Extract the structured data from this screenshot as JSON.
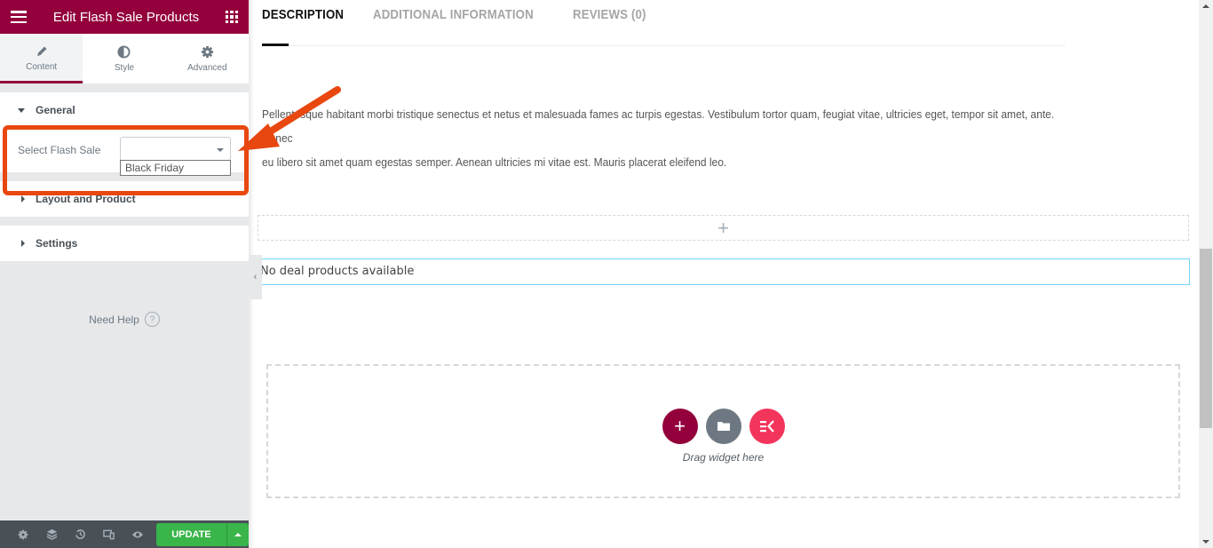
{
  "panel": {
    "title": "Edit Flash Sale Products",
    "tabs": [
      {
        "label": "Content",
        "icon": "pencil-icon",
        "active": true
      },
      {
        "label": "Style",
        "icon": "contrast-icon",
        "active": false
      },
      {
        "label": "Advanced",
        "icon": "gear-icon",
        "active": false
      }
    ],
    "sections": {
      "general": {
        "label": "General",
        "expanded": true
      },
      "layout": {
        "label": "Layout and Product",
        "expanded": false
      },
      "settings": {
        "label": "Settings",
        "expanded": false
      }
    },
    "select_flash_sale": {
      "label": "Select Flash Sale",
      "value": "",
      "options": [
        "Black Friday"
      ]
    },
    "need_help": "Need Help",
    "footer": {
      "update_label": "UPDATE",
      "icons": [
        "gear-icon",
        "layers-icon",
        "history-icon",
        "responsive-icon",
        "eye-icon"
      ]
    }
  },
  "main": {
    "tabs": [
      {
        "label": "DESCRIPTION",
        "active": true
      },
      {
        "label": "ADDITIONAL INFORMATION",
        "active": false
      },
      {
        "label": "REVIEWS (0)",
        "active": false
      }
    ],
    "description_line1": "Pellentesque habitant morbi tristique senectus et netus et malesuada fames ac turpis egestas. Vestibulum tortor quam, feugiat vitae, ultricies eget, tempor sit amet, ante. Donec",
    "description_line2": "eu libero sit amet quam egestas semper. Aenean ultricies mi vitae est. Mauris placerat eleifend leo.",
    "add_section_symbol": "+",
    "no_deal_text": "No deal products available",
    "drag_widget_text": "Drag widget here"
  },
  "colors": {
    "brand": "#93003c",
    "update_green": "#39b54a",
    "annotation_orange": "#e8470f",
    "selected_border": "#71d7f7"
  }
}
